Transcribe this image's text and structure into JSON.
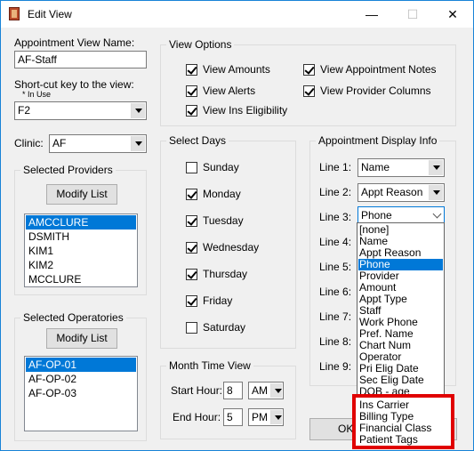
{
  "window": {
    "title": "Edit View",
    "minimize": "—",
    "maximize": "☐",
    "close": "✕"
  },
  "appointment_view_name": {
    "label": "Appointment View Name:",
    "value": "AF-Staff"
  },
  "shortcut": {
    "label": "Short-cut key to the view:",
    "note": "* In Use",
    "value": "F2"
  },
  "clinic": {
    "label": "Clinic:",
    "value": "AF"
  },
  "selected_providers": {
    "title": "Selected Providers",
    "modify_label": "Modify List",
    "items": [
      "AMCCLURE",
      "DSMITH",
      "KIM1",
      "KIM2",
      "MCCLURE"
    ],
    "selected_index": 0
  },
  "selected_operatories": {
    "title": "Selected Operatories",
    "modify_label": "Modify List",
    "items": [
      "AF-OP-01",
      "AF-OP-02",
      "AF-OP-03"
    ],
    "selected_index": 0
  },
  "view_options": {
    "title": "View Options",
    "items": [
      {
        "label": "View Amounts",
        "checked": true
      },
      {
        "label": "View Appointment Notes",
        "checked": true
      },
      {
        "label": "View Alerts",
        "checked": true
      },
      {
        "label": "View Provider Columns",
        "checked": true
      },
      {
        "label": "View Ins Eligibility",
        "checked": true
      }
    ]
  },
  "select_days": {
    "title": "Select Days",
    "days": [
      {
        "label": "Sunday",
        "checked": false
      },
      {
        "label": "Monday",
        "checked": true
      },
      {
        "label": "Tuesday",
        "checked": true
      },
      {
        "label": "Wednesday",
        "checked": true
      },
      {
        "label": "Thursday",
        "checked": true
      },
      {
        "label": "Friday",
        "checked": true
      },
      {
        "label": "Saturday",
        "checked": false
      }
    ]
  },
  "month_time_view": {
    "title": "Month Time View",
    "start_label": "Start Hour:",
    "start_hour": "8",
    "start_ampm": "AM",
    "end_label": "End Hour:",
    "end_hour": "5",
    "end_ampm": "PM"
  },
  "display_info": {
    "title": "Appointment Display Info",
    "lines": [
      {
        "label": "Line 1:",
        "value": "Name"
      },
      {
        "label": "Line 2:",
        "value": "Appt Reason"
      },
      {
        "label": "Line 3:",
        "value": "Phone"
      },
      {
        "label": "Line 4:",
        "value": ""
      },
      {
        "label": "Line 5:",
        "value": ""
      },
      {
        "label": "Line 6:",
        "value": ""
      },
      {
        "label": "Line 7:",
        "value": ""
      },
      {
        "label": "Line 8:",
        "value": ""
      },
      {
        "label": "Line 9:",
        "value": ""
      }
    ]
  },
  "dropdown_options": [
    "[none]",
    "Name",
    "Appt Reason",
    "Phone",
    "Provider",
    "Amount",
    "Appt Type",
    "Staff",
    "Work Phone",
    "Pref. Name",
    "Chart Num",
    "Operator",
    "Pri Elig Date",
    "Sec Elig Date",
    "DOB - age"
  ],
  "dropdown_highlight_index": 3,
  "highlighted_options": [
    "Ins Carrier",
    "Billing Type",
    "Financial Class",
    "Patient Tags"
  ],
  "highlight_color": "#e00000",
  "buttons": {
    "ok": "OK"
  }
}
